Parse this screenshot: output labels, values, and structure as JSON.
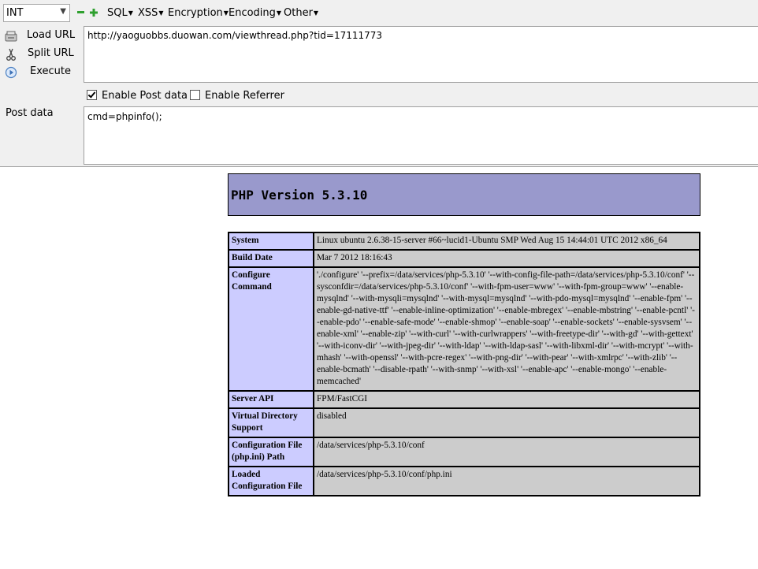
{
  "hackbar": {
    "type_select": {
      "value": "INT"
    },
    "menus": [
      "SQL",
      "XSS",
      "Encryption",
      "Encoding",
      "Other"
    ],
    "actions": {
      "load_url": "Load URL",
      "split_url": "Split URL",
      "execute": "Execute"
    },
    "url": "http://yaoguobbs.duowan.com/viewthread.php?tid=17111773",
    "enable_post": {
      "label": "Enable Post data",
      "checked": true
    },
    "enable_referrer": {
      "label": "Enable Referrer",
      "checked": false
    },
    "post_label": "Post data",
    "post_value": "cmd=phpinfo();"
  },
  "phpinfo": {
    "title": "PHP Version 5.3.10",
    "rows": [
      {
        "key": "System",
        "value": "Linux ubuntu 2.6.38-15-server #66~lucid1-Ubuntu SMP Wed Aug 15 14:44:01 UTC 2012 x86_64"
      },
      {
        "key": "Build Date",
        "value": "Mar 7 2012 18:16:43"
      },
      {
        "key": "Configure Command",
        "value": "'./configure' '--prefix=/data/services/php-5.3.10' '--with-config-file-path=/data/services/php-5.3.10/conf' '--sysconfdir=/data/services/php-5.3.10/conf' '--with-fpm-user=www' '--with-fpm-group=www' '--enable-mysqlnd' '--with-mysqli=mysqlnd' '--with-mysql=mysqlnd' '--with-pdo-mysql=mysqlnd' '--enable-fpm' '--enable-gd-native-ttf' '--enable-inline-optimization' '--enable-mbregex' '--enable-mbstring' '--enable-pcntl' '--enable-pdo' '--enable-safe-mode' '--enable-shmop' '--enable-soap' '--enable-sockets' '--enable-sysvsem' '--enable-xml' '--enable-zip' '--with-curl' '--with-curlwrappers' '--with-freetype-dir' '--with-gd' '--with-gettext' '--with-iconv-dir' '--with-jpeg-dir' '--with-ldap' '--with-ldap-sasl' '--with-libxml-dir' '--with-mcrypt' '--with-mhash' '--with-openssl' '--with-pcre-regex' '--with-png-dir' '--with-pear' '--with-xmlrpc' '--with-zlib' '--enable-bcmath' '--disable-rpath' '--with-snmp' '--with-xsl' '--enable-apc' '--enable-mongo' '--enable-memcached'"
      },
      {
        "key": "Server API",
        "value": "FPM/FastCGI"
      },
      {
        "key": "Virtual Directory Support",
        "value": "disabled"
      },
      {
        "key": "Configuration File (php.ini) Path",
        "value": "/data/services/php-5.3.10/conf"
      },
      {
        "key": "Loaded Configuration File",
        "value": "/data/services/php-5.3.10/conf/php.ini"
      }
    ]
  },
  "colors": {
    "header_bg": "#9999cc",
    "key_bg": "#ccccff",
    "value_bg": "#cccccc",
    "panel_bg": "#f0f0f0"
  },
  "icons": [
    "minus-icon",
    "plus-icon",
    "load-url-icon",
    "split-url-icon",
    "execute-icon",
    "dropdown-arrow-icon"
  ]
}
